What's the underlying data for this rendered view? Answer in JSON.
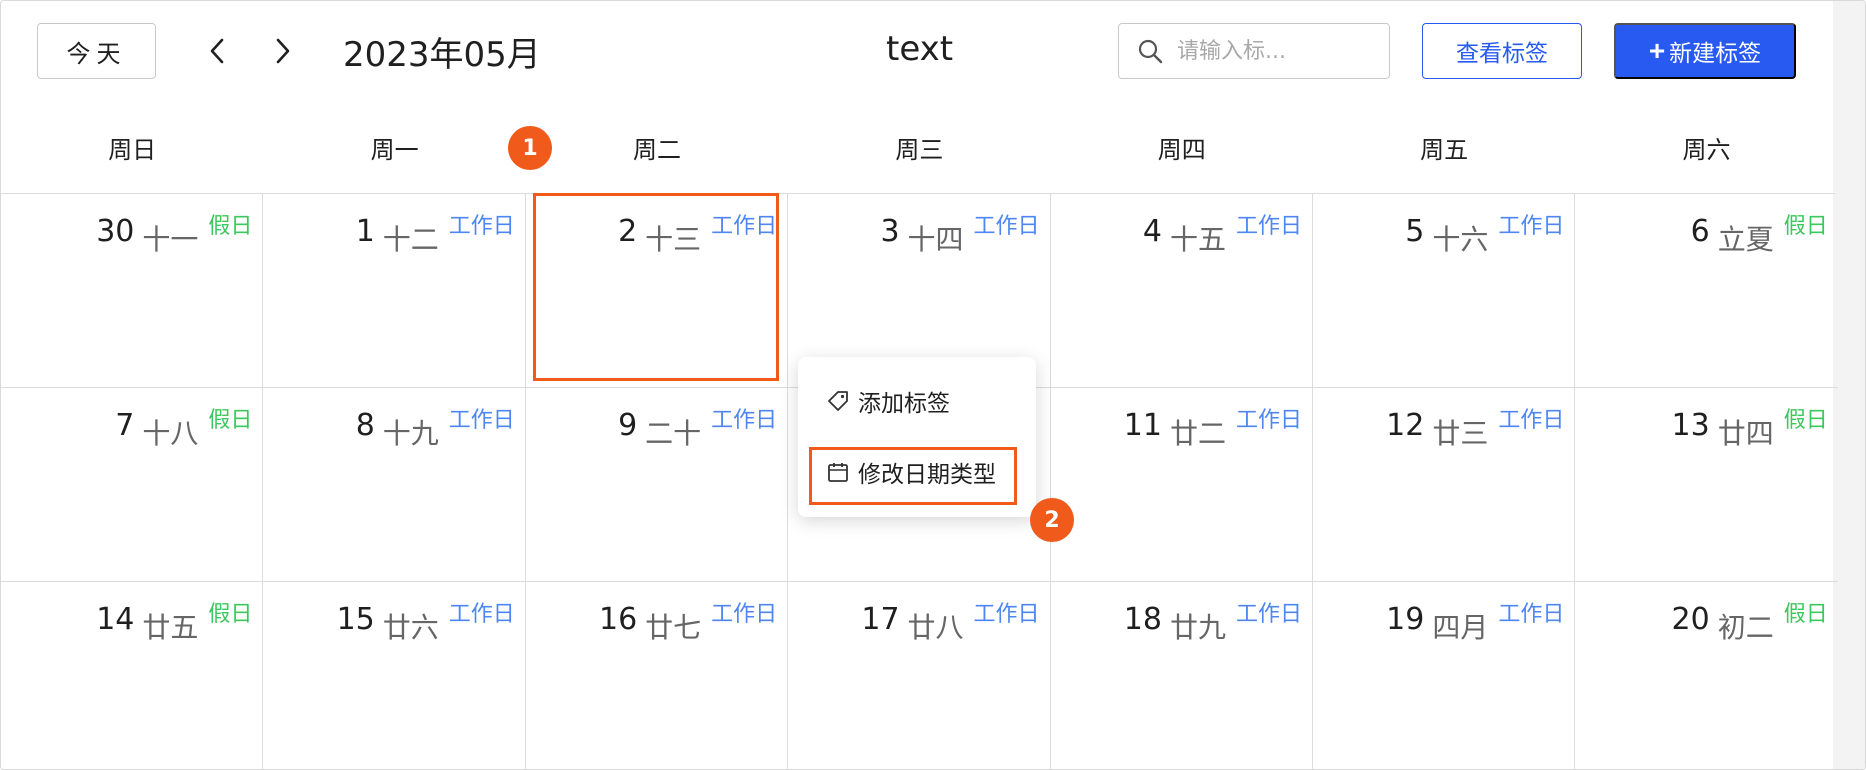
{
  "toolbar": {
    "today_label": "今天",
    "month_title": "2023年05月",
    "center_title": "text",
    "search_placeholder": "请输入标...",
    "view_tags_label": "查看标签",
    "new_tag_label": "新建标签",
    "new_tag_plus": "+"
  },
  "weekdays": [
    "周日",
    "周一",
    "周二",
    "周三",
    "周四",
    "周五",
    "周六"
  ],
  "weeks": [
    [
      {
        "day": "30",
        "lunar": "十一",
        "type": "假日",
        "kind": "holiday"
      },
      {
        "day": "1",
        "lunar": "十二",
        "type": "工作日",
        "kind": "workday"
      },
      {
        "day": "2",
        "lunar": "十三",
        "type": "工作日",
        "kind": "workday"
      },
      {
        "day": "3",
        "lunar": "十四",
        "type": "工作日",
        "kind": "workday"
      },
      {
        "day": "4",
        "lunar": "十五",
        "type": "工作日",
        "kind": "workday"
      },
      {
        "day": "5",
        "lunar": "十六",
        "type": "工作日",
        "kind": "workday"
      },
      {
        "day": "6",
        "lunar": "立夏",
        "type": "假日",
        "kind": "holiday"
      }
    ],
    [
      {
        "day": "7",
        "lunar": "十八",
        "type": "假日",
        "kind": "holiday"
      },
      {
        "day": "8",
        "lunar": "十九",
        "type": "工作日",
        "kind": "workday"
      },
      {
        "day": "9",
        "lunar": "二十",
        "type": "工作日",
        "kind": "workday"
      },
      {
        "day": "",
        "lunar": "",
        "type": "",
        "kind": "workday"
      },
      {
        "day": "11",
        "lunar": "廿二",
        "type": "工作日",
        "kind": "workday"
      },
      {
        "day": "12",
        "lunar": "廿三",
        "type": "工作日",
        "kind": "workday"
      },
      {
        "day": "13",
        "lunar": "廿四",
        "type": "假日",
        "kind": "holiday"
      }
    ],
    [
      {
        "day": "14",
        "lunar": "廿五",
        "type": "假日",
        "kind": "holiday"
      },
      {
        "day": "15",
        "lunar": "廿六",
        "type": "工作日",
        "kind": "workday"
      },
      {
        "day": "16",
        "lunar": "廿七",
        "type": "工作日",
        "kind": "workday"
      },
      {
        "day": "17",
        "lunar": "廿八",
        "type": "工作日",
        "kind": "workday"
      },
      {
        "day": "18",
        "lunar": "廿九",
        "type": "工作日",
        "kind": "workday"
      },
      {
        "day": "19",
        "lunar": "四月",
        "type": "工作日",
        "kind": "workday"
      },
      {
        "day": "20",
        "lunar": "初二",
        "type": "假日",
        "kind": "holiday"
      }
    ]
  ],
  "context_menu": {
    "add_tag": "添加标签",
    "change_date_type": "修改日期类型"
  },
  "badges": {
    "first": "1",
    "second": "2"
  },
  "colors": {
    "primary": "#2859f0",
    "holiday": "#3cc85c",
    "workday": "#4e86f2",
    "callout": "#f05a1a"
  }
}
